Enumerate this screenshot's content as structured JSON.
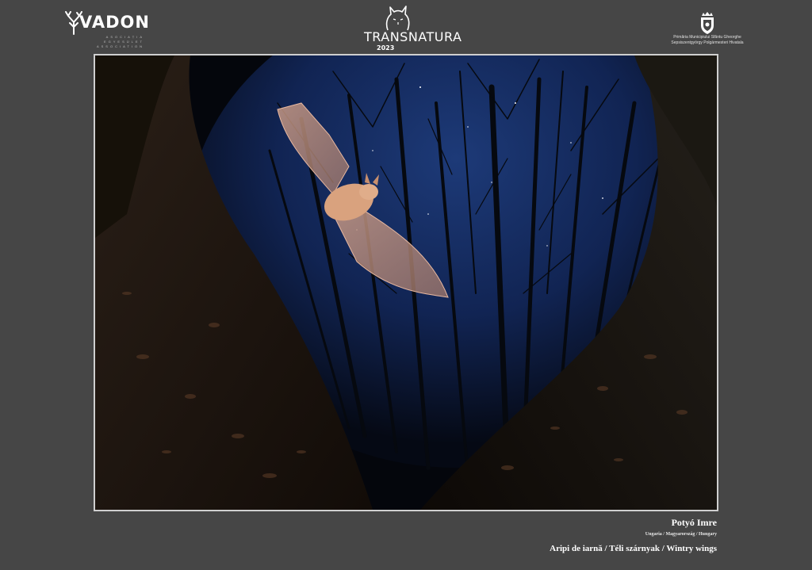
{
  "header": {
    "left_logo": {
      "name": "VADON",
      "subtitle_lines": [
        "ASOCIAȚIA",
        "EGYESÜLET",
        "ASSOCIATION"
      ],
      "icon": "antler-icon"
    },
    "center_logo": {
      "word_main": "TRANSNATURA",
      "year": "2023",
      "icon": "lynx-icon"
    },
    "right_logo": {
      "icon": "coat-of-arms-icon",
      "line1": "Primăria Municipiului Sfântu Gheorghe",
      "line2": "Sepsiszentgyörgy Polgármesteri Hivatala"
    }
  },
  "photo": {
    "subject": "bat-in-flight",
    "icon": "bat-photo"
  },
  "caption": {
    "author": "Potyó Imre",
    "country": "Ungaria / Magyarország / Hungary",
    "title": "Aripi de iarnă / Téli szárnyak / Wintry wings"
  },
  "colors": {
    "background": "#464646",
    "frame": "#cfcfcf",
    "text": "#ffffff"
  }
}
